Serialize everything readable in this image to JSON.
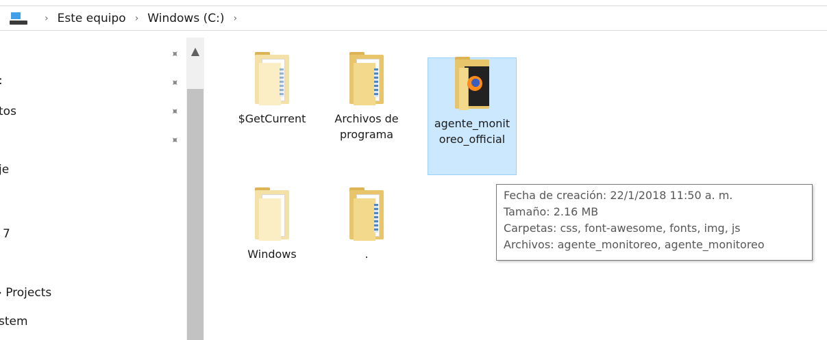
{
  "breadcrumb": {
    "items": [
      "Este equipo",
      "Windows (C:)"
    ],
    "separator": "›"
  },
  "nav": {
    "items": [
      ":",
      "tos",
      "je",
      "7",
      "› Projects",
      "stem"
    ]
  },
  "files": [
    {
      "name": "$GetCurrent"
    },
    {
      "name": "Archivos de programa"
    },
    {
      "name": "agente_monitoreo_official"
    },
    {
      "name": "Windows"
    },
    {
      "name": "."
    }
  ],
  "tooltip": {
    "created": "Fecha de creación: 22/1/2018 11:50 a. m.",
    "size": "Tamaño: 2.16 MB",
    "folders": "Carpetas: css, font-awesome, fonts, img, js",
    "files": "Archivos: agente_monitoreo, agente_monitoreo"
  },
  "colors": {
    "selection_bg": "#cce8ff",
    "selection_border": "#99d1ff",
    "folder": "#f3d98b"
  },
  "icons": {
    "pc": "this-pc-icon",
    "pin": "pin-icon",
    "scroll_up": "chevron-up-icon",
    "folder": "folder-icon"
  }
}
